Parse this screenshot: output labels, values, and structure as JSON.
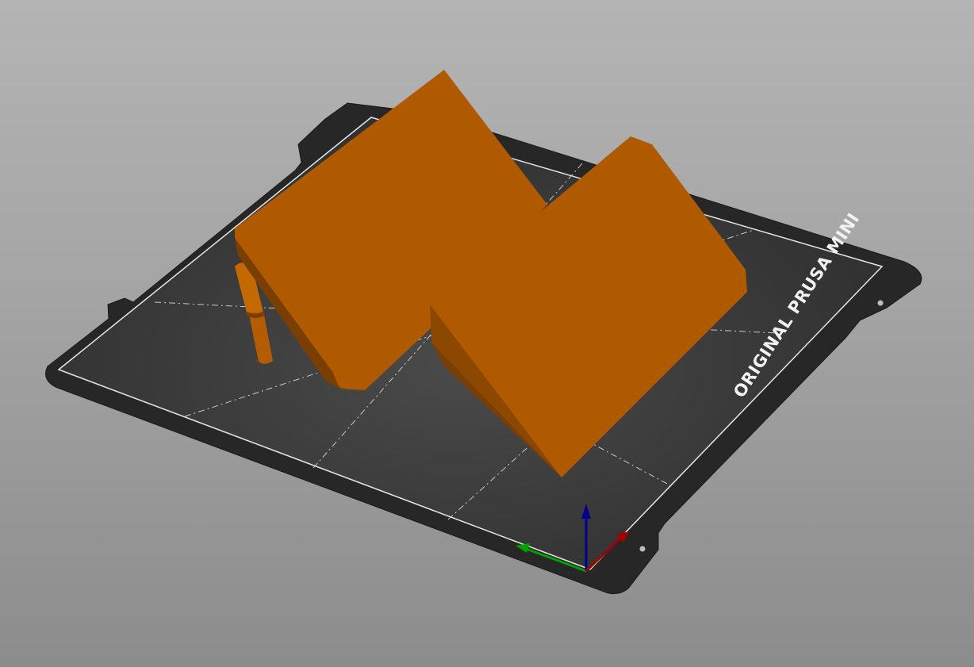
{
  "viewport": {
    "bed_label": "ORIGINAL PRUSA MINI"
  },
  "colors": {
    "background_top": "#b4b4b4",
    "background_bottom": "#8c8c8c",
    "bed": "#2e2e2e",
    "bed_surface": "#3a3a3a",
    "bed_border_line": "#ffffff",
    "grid_line": "#cfcfcf",
    "model_top": "#b05a00",
    "model_side": "#8f4a00",
    "model_dark": "#7a3f00",
    "axis_x": "#a00000",
    "axis_y": "#00a000",
    "axis_z": "#00008c"
  },
  "icons": {
    "axis_gizmo": "xyz-axes-icon"
  }
}
